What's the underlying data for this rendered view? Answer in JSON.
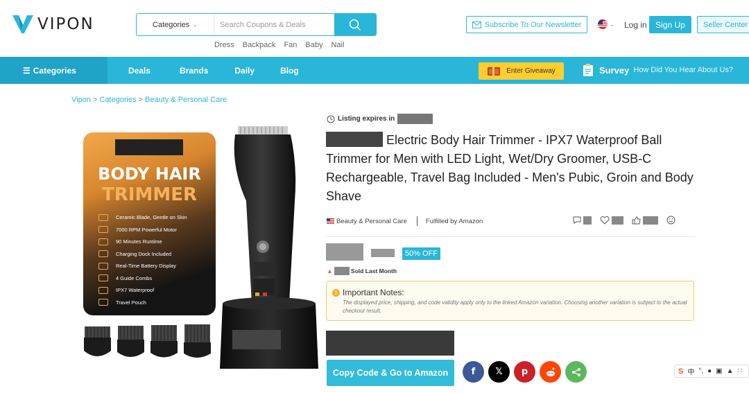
{
  "header": {
    "logo_text": "VIPON",
    "search": {
      "category_label": "Categories",
      "placeholder": "Search Coupons & Deals"
    },
    "hot_searches": [
      "Dress",
      "Backpack",
      "Fan",
      "Baby",
      "Nail"
    ],
    "newsletter_label": "Subscribe To Our Newsletter",
    "login_label": "Log in",
    "signup_label": "Sign Up",
    "seller_label": "Seller Center"
  },
  "nav": {
    "categories_label": "Categories",
    "links": [
      "Deals",
      "Brands",
      "Daily",
      "Blog"
    ],
    "giveaway_label": "Enter Giveaway",
    "survey_title": "Survey",
    "survey_subtitle": "How Did You Hear About Us?"
  },
  "breadcrumb": [
    "Vipon",
    "Categories",
    "Beauty & Personal Care"
  ],
  "promo": {
    "title_line1": "BODY HAIR",
    "title_line2": "TRIMMER",
    "features": [
      "Ceramic Blade, Gentle on Skin",
      "7000 RPM Powerful Motor",
      "90 Minutes Runtime",
      "Charging Dock Included",
      "Real-Time Battery Display",
      "4 Guide Combs",
      "IPX7 Waterproof",
      "Travel Pouch"
    ]
  },
  "product": {
    "expires_label": "Listing expires in",
    "title": "Electric Body Hair Trimmer - IPX7 Waterproof Ball Trimmer for Men with LED Light, Wet/Dry Groomer, USB-C Rechargeable, Travel Bag Included - Men's Pubic, Groin and Body Shave",
    "category": "Beauty & Personal Care",
    "fulfillment": "Fulfilled by Amazon",
    "discount": "50% OFF",
    "sold_label": "Sold Last Month",
    "notes_title": "Important Notes:",
    "notes_body": "The displayed price, shipping, and code validity apply only to the linked Amazon variation. Choosing another variation is subject to the actual checkout result.",
    "cta_label": "Copy Code & Go to Amazon"
  },
  "share": {
    "icons": [
      "facebook-icon",
      "x-icon",
      "pinterest-icon",
      "reddit-icon",
      "share-icon"
    ],
    "colors": [
      "#3b5998",
      "#000000",
      "#cb2027",
      "#ff4500",
      "#5cb85c"
    ]
  },
  "ime": {
    "brand": "S",
    "lang": "中"
  },
  "colors": {
    "accent": "#29b6d8",
    "nav_dark": "#1fa3c6",
    "giveaway": "#ffcd2e",
    "notes_border": "#f1cc6e"
  }
}
